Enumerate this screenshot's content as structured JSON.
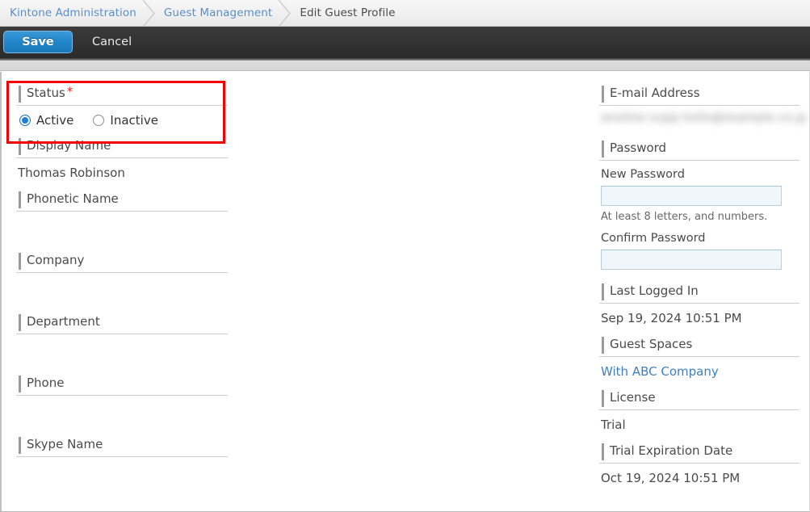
{
  "breadcrumb": {
    "items": [
      {
        "label": "Kintone Administration",
        "current": false
      },
      {
        "label": "Guest Management",
        "current": false
      },
      {
        "label": "Edit Guest Profile",
        "current": true
      }
    ]
  },
  "toolbar": {
    "save_label": "Save",
    "cancel_label": "Cancel"
  },
  "left_column": {
    "status": {
      "label": "Status",
      "required_marker": "*",
      "options": [
        {
          "label": "Active",
          "selected": true
        },
        {
          "label": "Inactive",
          "selected": false
        }
      ]
    },
    "display_name": {
      "label": "Display Name",
      "value": "Thomas Robinson"
    },
    "phonetic_name": {
      "label": "Phonetic Name",
      "value": ""
    },
    "company": {
      "label": "Company",
      "value": ""
    },
    "department": {
      "label": "Department",
      "value": ""
    },
    "phone": {
      "label": "Phone",
      "value": ""
    },
    "skype_name": {
      "label": "Skype Name",
      "value": ""
    }
  },
  "right_column": {
    "email": {
      "label": "E-mail Address",
      "value": "another.supp.hello@example.co.jp"
    },
    "password": {
      "label": "Password",
      "new_password_label": "New Password",
      "new_password_value": "",
      "new_password_placeholder": "",
      "hint": "At least 8 letters, and numbers.",
      "confirm_password_label": "Confirm Password",
      "confirm_password_value": "",
      "confirm_password_placeholder": ""
    },
    "last_logged_in": {
      "label": "Last Logged In",
      "value": "Sep 19, 2024 10:51 PM"
    },
    "guest_spaces": {
      "label": "Guest Spaces",
      "value": "With ABC Company"
    },
    "license": {
      "label": "License",
      "value": "Trial"
    },
    "trial_expiration": {
      "label": "Trial Expiration Date",
      "value": "Oct 19, 2024 10:51 PM"
    }
  },
  "colors": {
    "accent_blue": "#2185c9",
    "link_blue": "#5b8fc9",
    "highlight_red": "#f30000",
    "required_red": "#e02020",
    "toolbar_dark": "#333333"
  }
}
